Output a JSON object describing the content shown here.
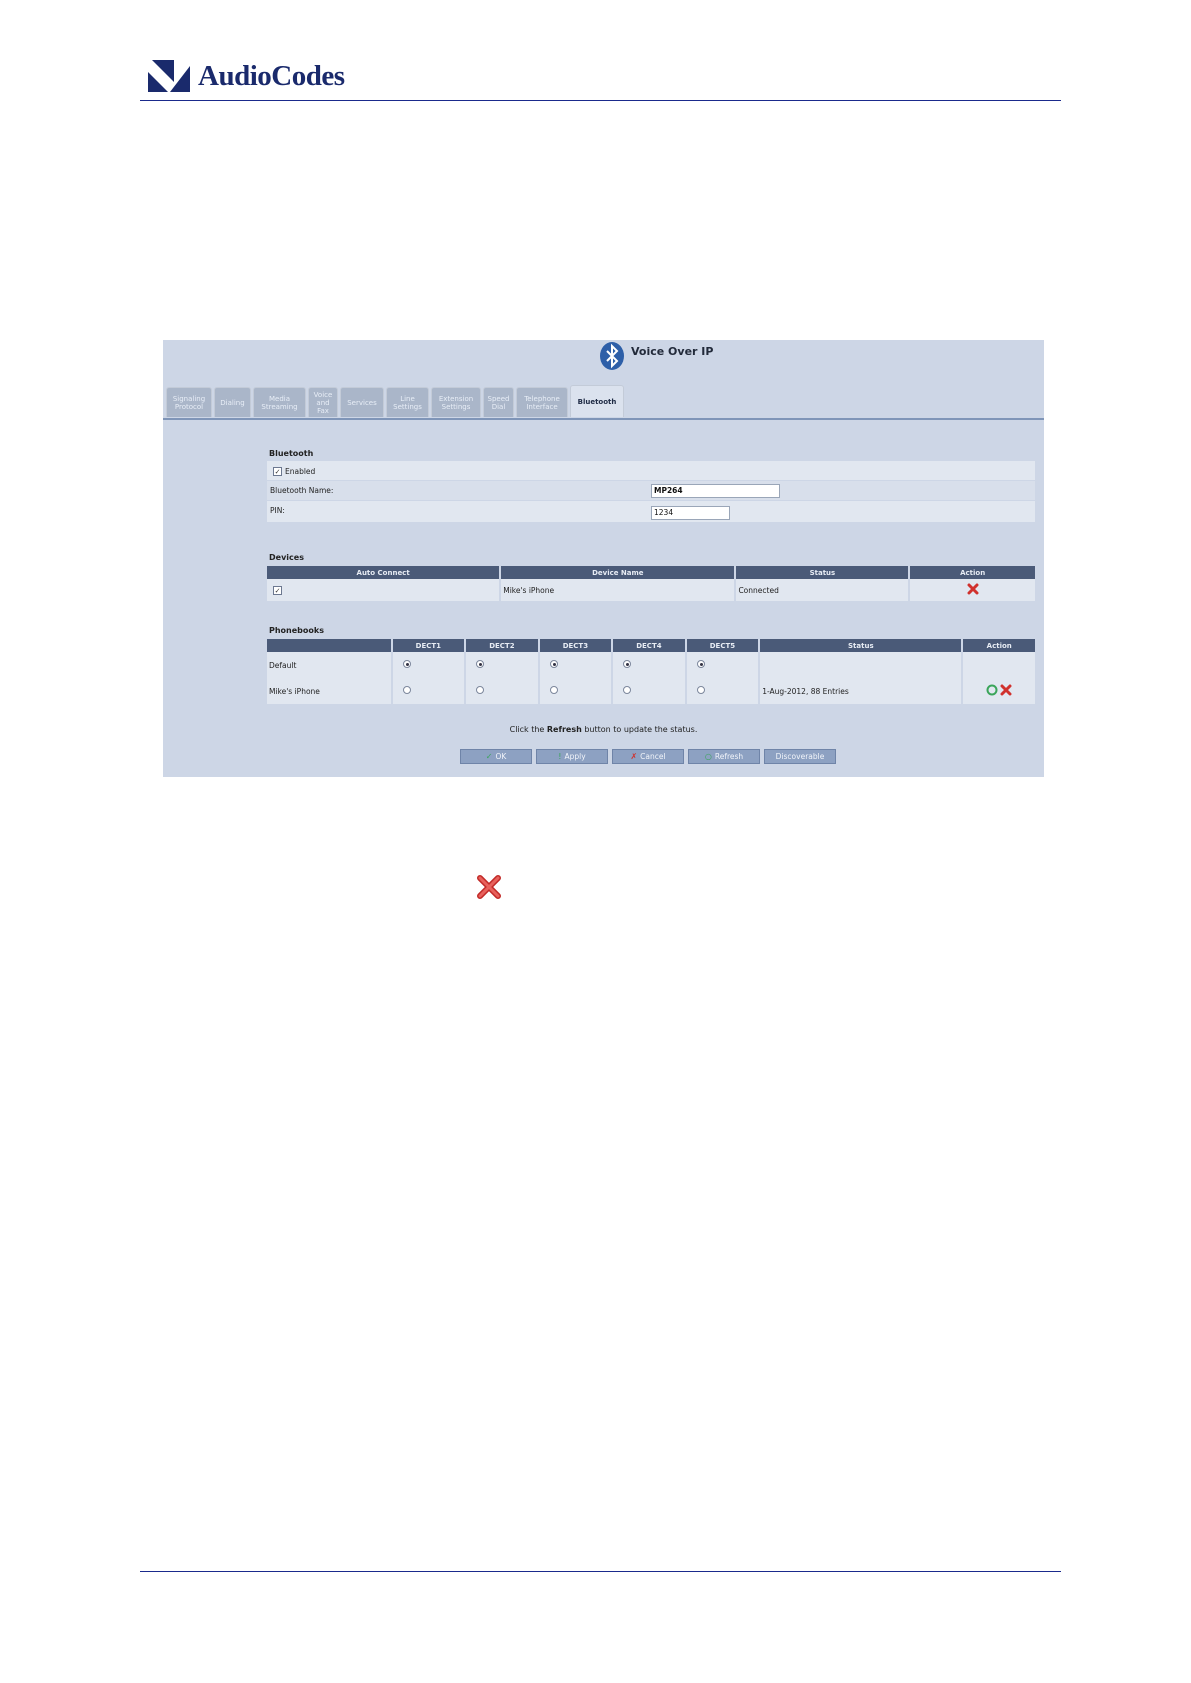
{
  "header": {
    "brand": "AudioCodes"
  },
  "app": {
    "title": "Voice Over IP"
  },
  "tabs": [
    {
      "label": "Signaling Protocol"
    },
    {
      "label": "Dialing"
    },
    {
      "label": "Media Streaming"
    },
    {
      "label": "Voice and Fax"
    },
    {
      "label": "Services"
    },
    {
      "label": "Line Settings"
    },
    {
      "label": "Extension Settings"
    },
    {
      "label": "Speed Dial"
    },
    {
      "label": "Telephone Interface"
    },
    {
      "label": "Bluetooth"
    }
  ],
  "active_tab": "Bluetooth",
  "bluetooth": {
    "section_title": "Bluetooth",
    "enabled_label": "Enabled",
    "enabled": true,
    "name_label": "Bluetooth Name:",
    "name_value": "MP264",
    "pin_label": "PIN:",
    "pin_value": "1234"
  },
  "devices": {
    "section_title": "Devices",
    "columns": [
      "Auto Connect",
      "Device Name",
      "Status",
      "Action"
    ],
    "rows": [
      {
        "auto_connect": true,
        "device_name": "Mike's iPhone",
        "status": "Connected",
        "action": "delete-icon"
      }
    ]
  },
  "phonebooks": {
    "section_title": "Phonebooks",
    "columns": [
      "",
      "DECT1",
      "DECT2",
      "DECT3",
      "DECT4",
      "DECT5",
      "Status",
      "Action"
    ],
    "rows": [
      {
        "name": "Default",
        "dect": [
          true,
          true,
          true,
          true,
          true
        ],
        "status": "",
        "actions": []
      },
      {
        "name": "Mike's iPhone",
        "dect": [
          false,
          false,
          false,
          false,
          false
        ],
        "status": "1-Aug-2012, 88 Entries",
        "actions": [
          "refresh-icon",
          "delete-icon"
        ]
      }
    ]
  },
  "note": {
    "prefix": "Click the ",
    "bold": "Refresh",
    "suffix": " button to update the status."
  },
  "buttons": [
    {
      "label": "OK",
      "icon": "check-icon"
    },
    {
      "label": "Apply",
      "icon": "apply-icon"
    },
    {
      "label": "Cancel",
      "icon": "cancel-icon"
    },
    {
      "label": "Refresh",
      "icon": "refresh-icon"
    },
    {
      "label": "Discoverable",
      "icon": ""
    }
  ],
  "colors": {
    "brand": "#1a2a6c",
    "panel": "#cdd6e6",
    "header_cell": "#4a5a78",
    "delete": "#d0312d",
    "refresh": "#3aa55a"
  }
}
